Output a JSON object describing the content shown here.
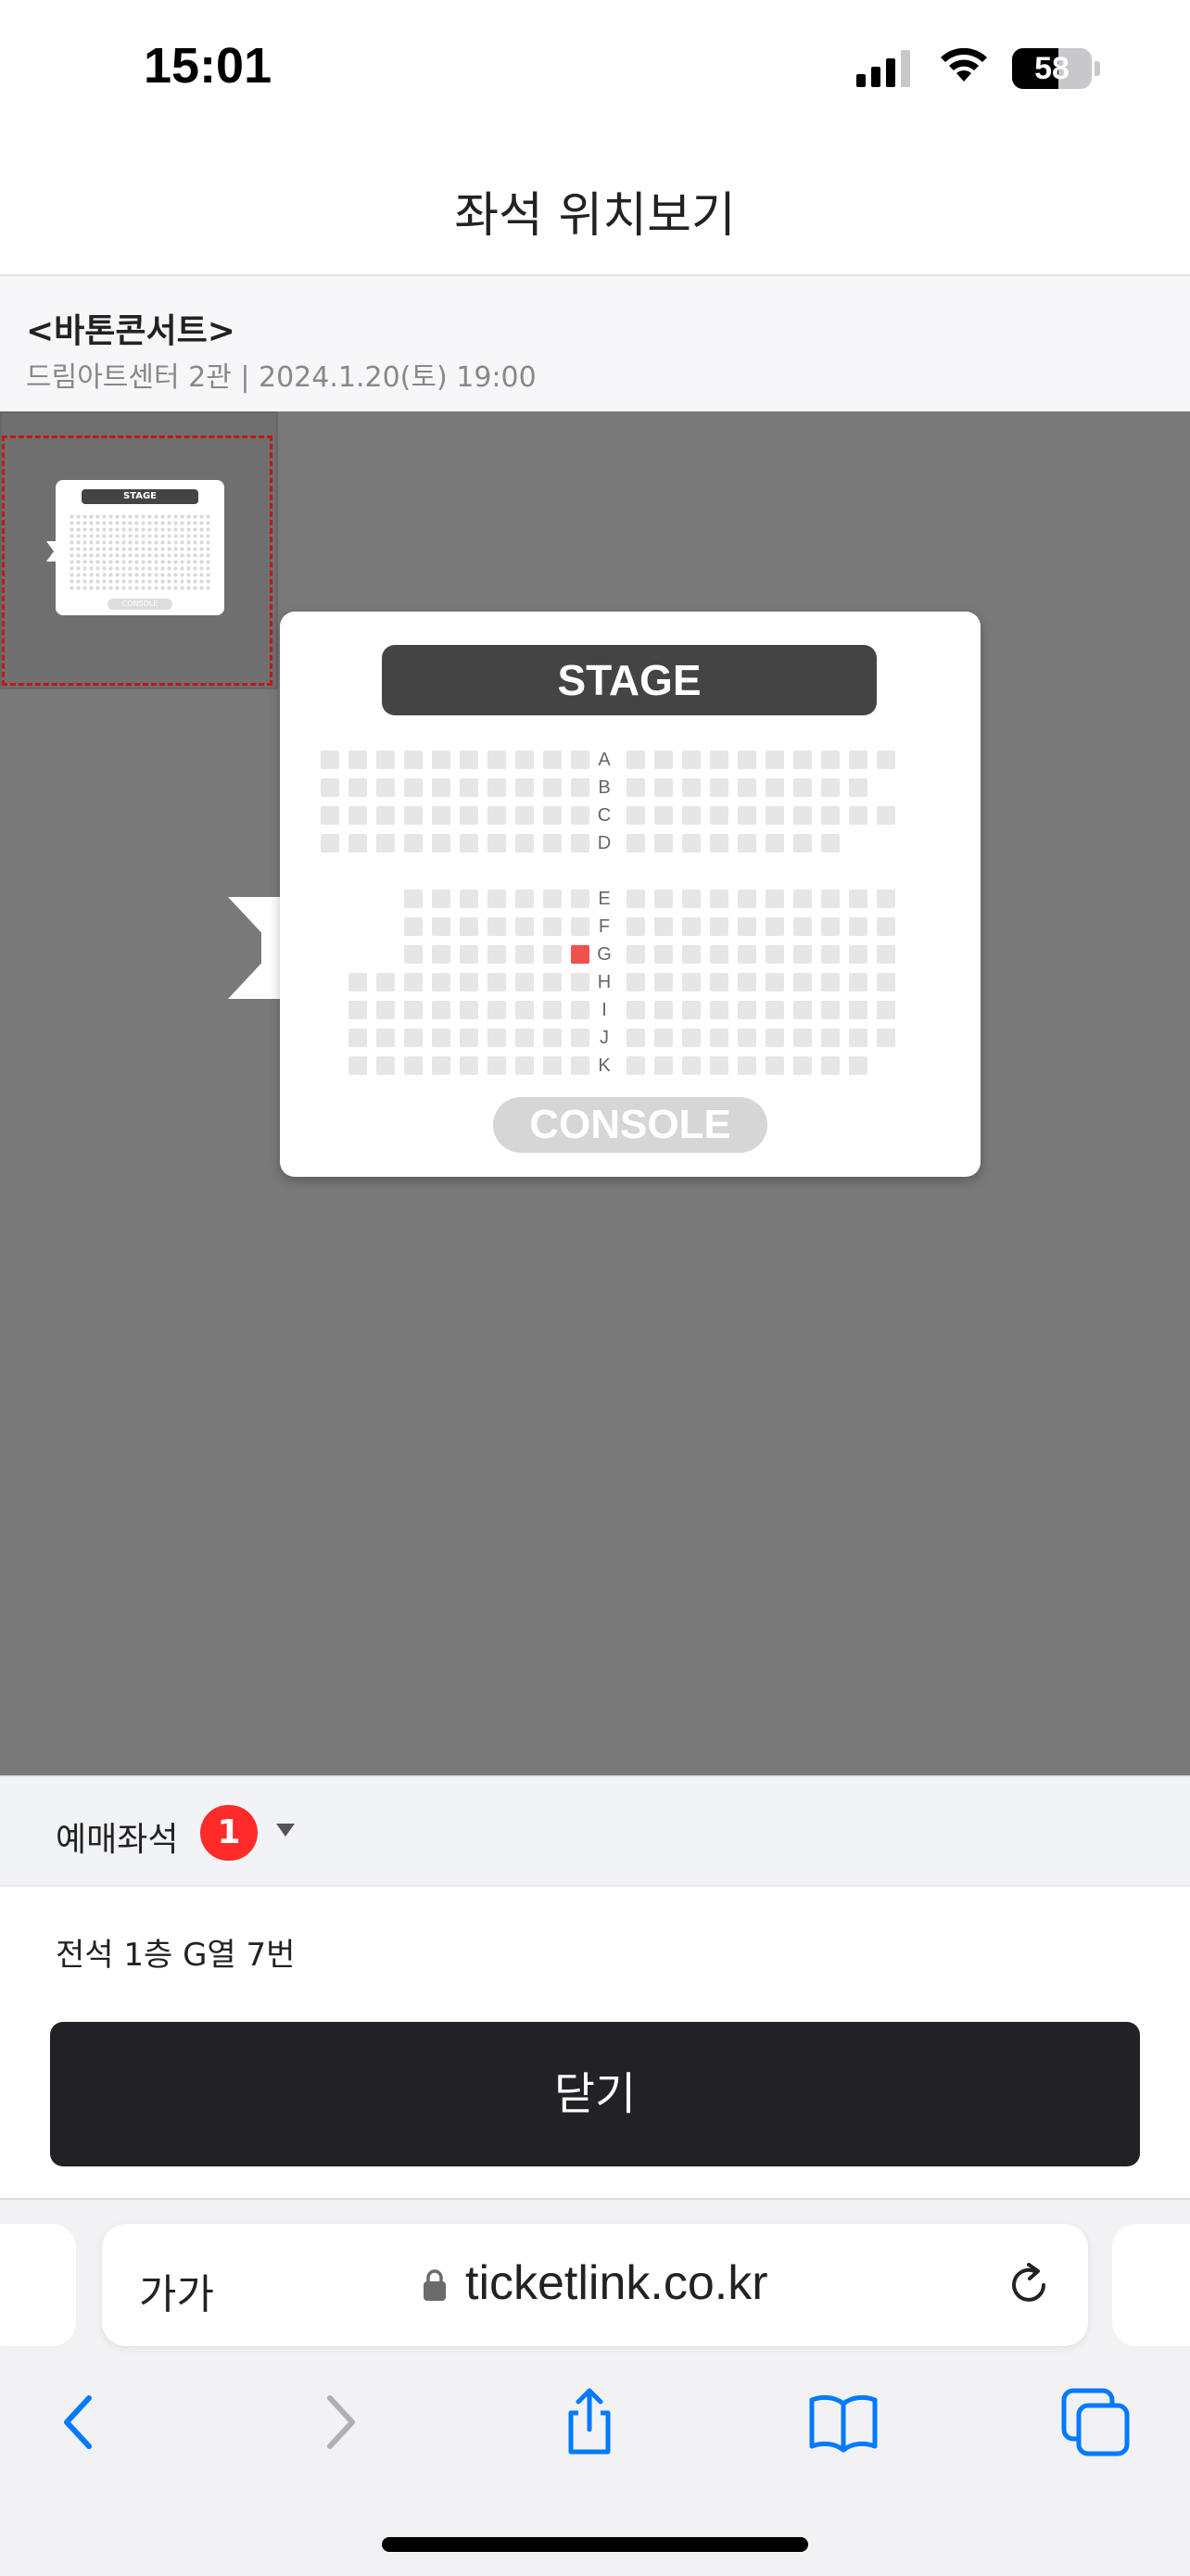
{
  "status_bar": {
    "time": "15:01",
    "battery": "58",
    "battery_level": 0.58
  },
  "header": {
    "title": "좌석 위치보기"
  },
  "event": {
    "title": "<바톤콘서트>",
    "subtitle": "드림아트센터 2관 | 2024.1.20(토) 19:00"
  },
  "map": {
    "minimap_stage": "STAGE",
    "minimap_console": "CONSOLE",
    "stage_label": "STAGE",
    "console_label": "CONSOLE",
    "rows": [
      "A",
      "B",
      "C",
      "D",
      "E",
      "F",
      "G",
      "H",
      "I",
      "J",
      "K"
    ],
    "selected_seat": {
      "row": "G",
      "number": 7
    }
  },
  "booked": {
    "label": "예매좌석",
    "count": "1"
  },
  "seat_info": {
    "text": "전석 1층 G열 7번"
  },
  "close_button": {
    "label": "닫기"
  },
  "safari": {
    "aa_label": "가가",
    "url": "ticketlink.co.kr"
  },
  "colors": {
    "selected_seat": "#f0514f",
    "badge": "#ff2a2a",
    "button": "#222226",
    "ios_blue": "#007aff"
  }
}
